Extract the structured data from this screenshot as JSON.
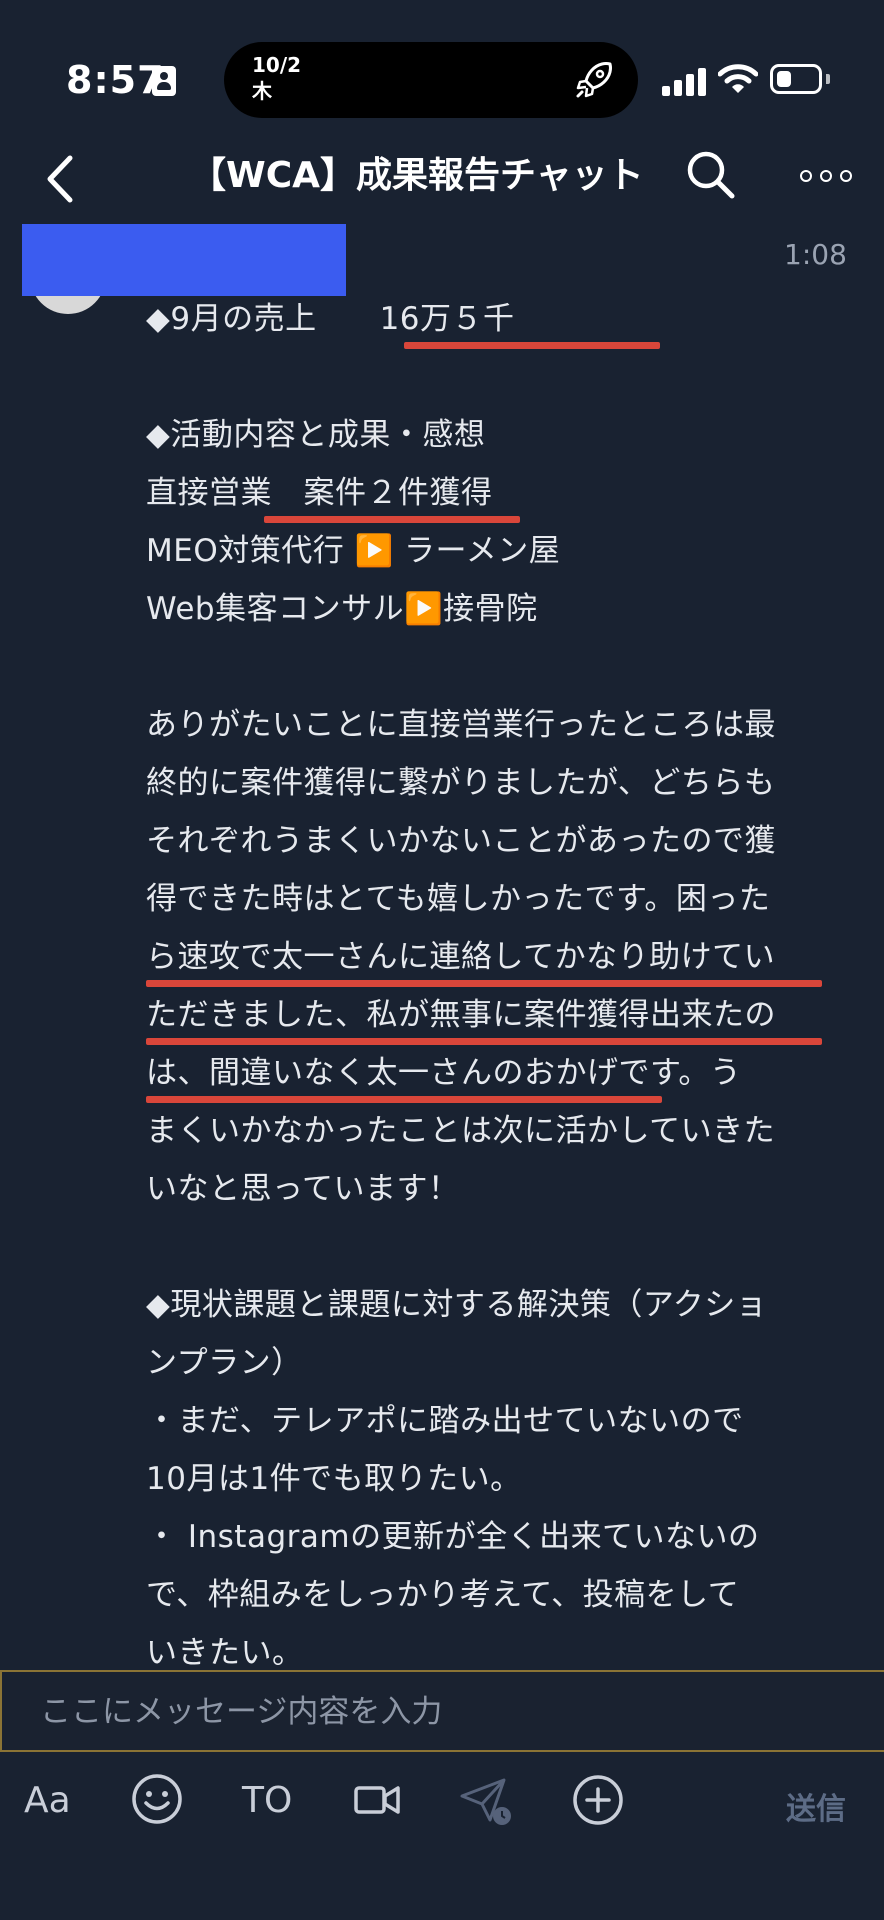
{
  "status_bar": {
    "time": "8:57",
    "island_date_line1": "10/2",
    "island_date_line2": "木"
  },
  "header": {
    "title": "【WCA】成果報告チャット"
  },
  "message": {
    "time": "1:08",
    "lines": [
      "◆9月の売上　　16万５千",
      "",
      "◆活動内容と成果・感想",
      "直接営業　案件２件獲得",
      "MEO対策代行 ▶️ ラーメン屋",
      "Web集客コンサル▶️接骨院",
      "",
      "ありがたいことに直接営業行ったところは最",
      "終的に案件獲得に繋がりましたが、どちらも",
      "それぞれうまくいかないことがあったので獲",
      "得できた時はとても嬉しかったです。困った",
      "ら速攻で太一さんに連絡してかなり助けてい",
      "ただきました、私が無事に案件獲得出来たの",
      "は、間違いなく太一さんのおかげです。う",
      "まくいかなかったことは次に活かしていきた",
      "いなと思っています！",
      "",
      "◆現状課題と課題に対する解決策（アクショ",
      "ンプラン）",
      "・まだ、テレアポに踏み出せていないので",
      "10月は1件でも取りたい。",
      "・ Instagramの更新が全く出来ていないの",
      "で、枠組みをしっかり考えて、投稿をして",
      "いきたい。"
    ]
  },
  "input": {
    "placeholder": "ここにメッセージ内容を入力"
  },
  "toolbar": {
    "font_label": "Aa",
    "to_label": "TO",
    "send_label": "送信"
  },
  "colors": {
    "background": "#192231",
    "underline": "#d9463a",
    "redaction": "#3b5cf0",
    "input_border": "#8b7435"
  }
}
